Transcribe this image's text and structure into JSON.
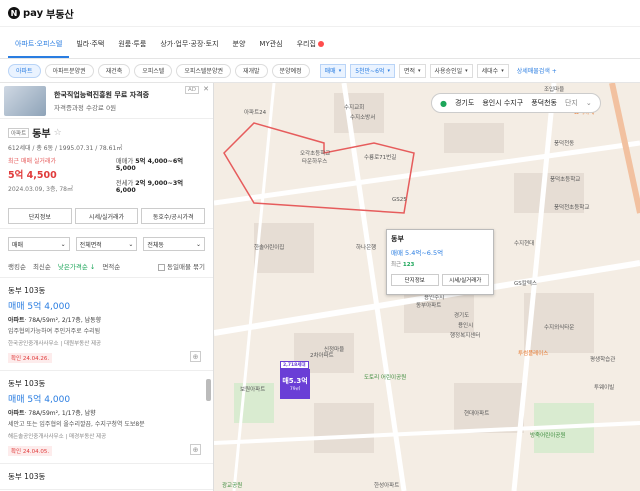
{
  "brand": {
    "logo": "N",
    "name": "pay",
    "sub": "부동산"
  },
  "menu": [
    {
      "label": "아파트·오피스텔",
      "active": true
    },
    {
      "label": "빌라·주택"
    },
    {
      "label": "원룸·투룸"
    },
    {
      "label": "상가·업무·공장·토지"
    },
    {
      "label": "분양"
    },
    {
      "label": "MY관심"
    },
    {
      "label": "우리집"
    }
  ],
  "filters": {
    "chips": [
      "아파트",
      "아파트분양권",
      "재건축",
      "오피스텔",
      "오피스텔분양권",
      "재개발",
      "분양예정"
    ],
    "drops": [
      "매매",
      "5천만~6억",
      "면적",
      "사용승인일",
      "세대수"
    ],
    "extra": "상세매물검색 +"
  },
  "ad": {
    "badge": "AD",
    "close": "✕",
    "title": "한국직업능력진흥원 무료 자격증",
    "subtitle": "자격증과정 수강료 0원"
  },
  "complex": {
    "type": "아파트",
    "name": "동부",
    "meta": "612세대 / 총 6동 / 1995.07.31 / 78.61㎡",
    "recent_label": "최근 매매 실거래가",
    "recent_price": "5억 4,500",
    "recent_date": "2024.03.09, 3층, 78㎡",
    "sale_label": "매매가",
    "sale_range": "5억 4,000~6억 5,000",
    "jeonse_label": "전세가",
    "jeonse_range": "2억 9,000~3억 6,000",
    "buttons": [
      "단지정보",
      "시세/실거래가",
      "동호수/공시가격"
    ]
  },
  "selects": [
    "매매",
    "전체면적",
    "전체동"
  ],
  "sort": {
    "options": [
      "랭킹순",
      "최신순",
      "낮은가격순 ↓",
      "면적순"
    ],
    "checkbox": "동일매물 묶기"
  },
  "listings": [
    {
      "name": "동부 103동",
      "price": "매매 5억 4,000",
      "spec_type": "아파트",
      "spec": "· 78A/59m², 2/17층, 남동향",
      "desc": "입주협의가능하여 주인거주로 수리됨",
      "agent": "한국공인중개사사무소 | 대원부동산 제공",
      "confirm": "확인 24.04.26."
    },
    {
      "name": "동부 103동",
      "price": "매매 5억 4,000",
      "spec_type": "아파트",
      "spec": "· 78A/59m², 1/17층, 남향",
      "desc": "세안고 또는 입주협의 올수리깔끔, 수지구청역 도보8분",
      "agent": "해든솔공인중개사사무소 | 매경부동산 제공",
      "confirm": "확인 24.04.05."
    },
    {
      "name": "동부 103동"
    }
  ],
  "address": {
    "province": "경기도",
    "city": "용인시 수지구",
    "dong": "풍덕천동",
    "complex": "단지"
  },
  "popup": {
    "name": "동부",
    "price": "매매 5.4억~6.5억",
    "recent_label": "최근",
    "recent_value": "123",
    "buttons": [
      "단지정보",
      "시세/실거래가"
    ]
  },
  "marker": {
    "count": "2,718세대",
    "price": "매5.3억",
    "area": "79㎡"
  },
  "map_labels": [
    "수지교회",
    "조입마을",
    "수지소방서",
    "아파트24",
    "요리까페",
    "오각초등학교",
    "타운하우스",
    "수룡로71번길",
    "풍덕천동",
    "GS25",
    "풍덕초등학교",
    "수지현대",
    "풍덕천초등학교",
    "하나은행",
    "용인수지",
    "동부아파트",
    "GS칼텍스",
    "수지외식타운",
    "용인시",
    "한솔어린이집",
    "경기도",
    "행정복지센터",
    "신정마을",
    "2차아파트",
    "보원아파트",
    "현대아파트",
    "도토리 어린이공원",
    "평생학습관",
    "투썸플레이스",
    "방죽어린이공원",
    "한성아파트",
    "광교공원",
    "투웨이빌"
  ],
  "icons": {
    "search": "search-icon",
    "pin": "pin-icon",
    "star": "star-icon"
  }
}
